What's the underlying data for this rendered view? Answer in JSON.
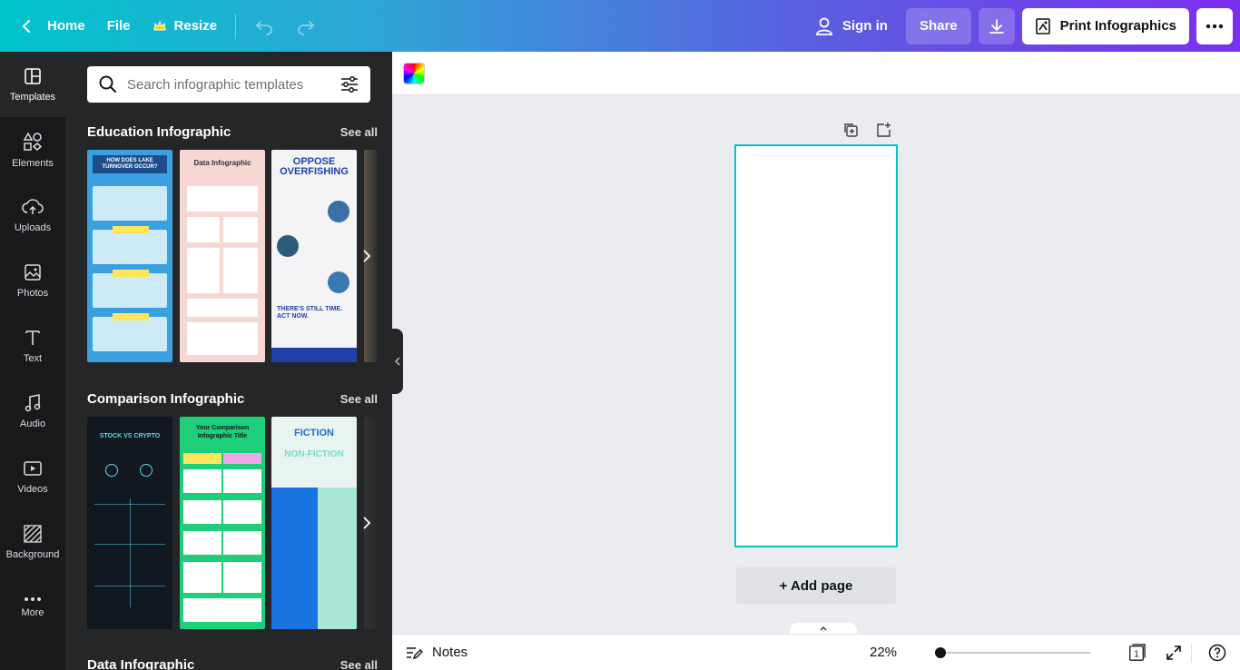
{
  "topbar": {
    "home_label": "Home",
    "file_label": "File",
    "resize_label": "Resize",
    "signin_label": "Sign in",
    "share_label": "Share",
    "print_label": "Print Infographics"
  },
  "rail": {
    "items": [
      {
        "label": "Templates",
        "icon": "templates-icon"
      },
      {
        "label": "Elements",
        "icon": "elements-icon"
      },
      {
        "label": "Uploads",
        "icon": "uploads-icon"
      },
      {
        "label": "Photos",
        "icon": "photos-icon"
      },
      {
        "label": "Text",
        "icon": "text-icon"
      },
      {
        "label": "Audio",
        "icon": "audio-icon"
      },
      {
        "label": "Videos",
        "icon": "videos-icon"
      },
      {
        "label": "Background",
        "icon": "background-icon"
      },
      {
        "label": "More",
        "icon": "more-icon"
      }
    ]
  },
  "panel": {
    "search_placeholder": "Search infographic templates",
    "sections": [
      {
        "title": "Education Infographic",
        "see_all": "See all",
        "thumbs": [
          {
            "text1": "HOW DOES LAKE TURNOVER OCCUR?",
            "text2": "",
            "bg": "#3aa0e0"
          },
          {
            "text1": "Data Infographic",
            "text2": "",
            "bg": "#f6d7d2"
          },
          {
            "text1": "OPPOSE OVERFISHING",
            "text2": "THERE'S STILL TIME. ACT NOW.",
            "bg": "#f4f4f6"
          },
          {
            "text1": "",
            "text2": "",
            "bg": "#7a6a58"
          }
        ]
      },
      {
        "title": "Comparison Infographic",
        "see_all": "See all",
        "thumbs": [
          {
            "text1": "STOCK VS CRYPTO",
            "text2": "",
            "bg": "#121820"
          },
          {
            "text1": "Your Comparison Infographic Title",
            "text2": "",
            "bg": "#1dcf7a"
          },
          {
            "text1": "FICTION",
            "text2": "NON-FICTION",
            "bg": "#e8f4f2"
          },
          {
            "text1": "",
            "text2": "",
            "bg": "#3a3a3a"
          }
        ]
      },
      {
        "title": "Data Infographic",
        "see_all": "See all",
        "thumbs": []
      }
    ]
  },
  "canvas": {
    "add_page_label": "+ Add page"
  },
  "bottom": {
    "notes_label": "Notes",
    "zoom_label": "22%",
    "zoom_value": 22,
    "page_count": "1"
  }
}
